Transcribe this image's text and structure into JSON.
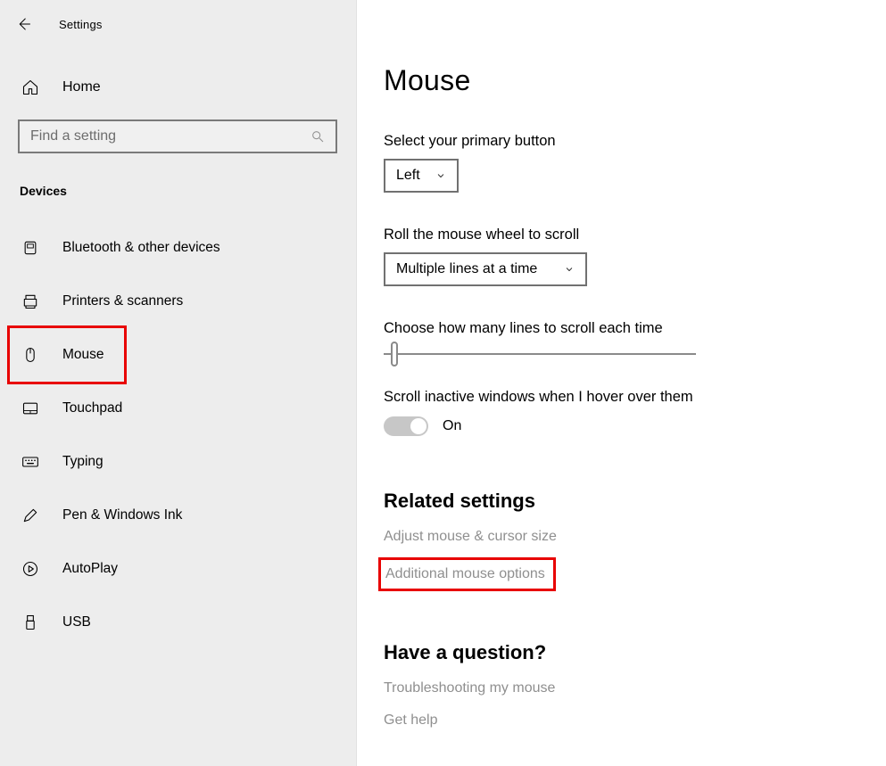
{
  "window": {
    "title": "Settings"
  },
  "sidebar": {
    "home_label": "Home",
    "search_placeholder": "Find a setting",
    "section_label": "Devices",
    "items": [
      {
        "id": "bluetooth",
        "label": "Bluetooth & other devices"
      },
      {
        "id": "printers",
        "label": "Printers & scanners"
      },
      {
        "id": "mouse",
        "label": "Mouse",
        "selected": true
      },
      {
        "id": "touchpad",
        "label": "Touchpad"
      },
      {
        "id": "typing",
        "label": "Typing"
      },
      {
        "id": "pen",
        "label": "Pen & Windows Ink"
      },
      {
        "id": "autoplay",
        "label": "AutoPlay"
      },
      {
        "id": "usb",
        "label": "USB"
      }
    ]
  },
  "page": {
    "title": "Mouse",
    "primary_button": {
      "label": "Select your primary button",
      "value": "Left"
    },
    "wheel": {
      "label": "Roll the mouse wheel to scroll",
      "value": "Multiple lines at a time"
    },
    "lines": {
      "label": "Choose how many lines to scroll each time"
    },
    "inactive": {
      "label": "Scroll inactive windows when I hover over them",
      "state": "On"
    },
    "related": {
      "heading": "Related settings",
      "links": [
        "Adjust mouse & cursor size",
        "Additional mouse options"
      ]
    },
    "question": {
      "heading": "Have a question?",
      "links": [
        "Troubleshooting my mouse",
        "Get help"
      ]
    }
  }
}
